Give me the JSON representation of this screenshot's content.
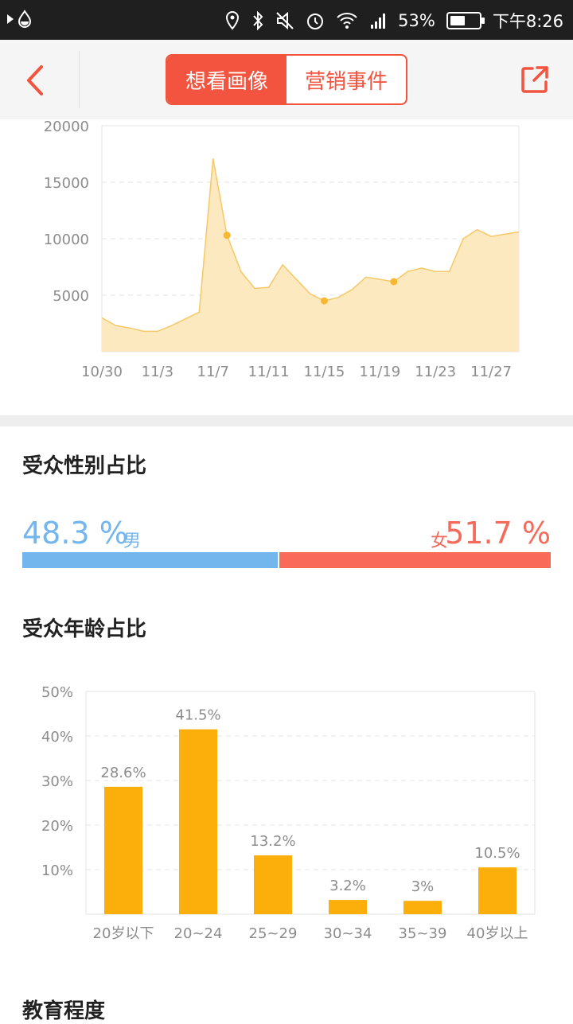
{
  "status_bar": {
    "battery_percent": "53%",
    "time": "下午8:26",
    "battery_level": 0.53
  },
  "nav": {
    "tabs": [
      "想看画像",
      "营销事件"
    ],
    "active_tab": 0
  },
  "trend_chart": {
    "chart_data": {
      "type": "area",
      "x": [
        "10/30",
        "10/31",
        "11/1",
        "11/2",
        "11/3",
        "11/4",
        "11/5",
        "11/6",
        "11/7",
        "11/8",
        "11/9",
        "11/10",
        "11/11",
        "11/12",
        "11/13",
        "11/14",
        "11/15",
        "11/16",
        "11/17",
        "11/18",
        "11/19",
        "11/20",
        "11/21",
        "11/22",
        "11/23",
        "11/24",
        "11/25",
        "11/26",
        "11/27",
        "11/28",
        "11/29"
      ],
      "values": [
        3000,
        2300,
        2100,
        1800,
        1800,
        2300,
        2900,
        3500,
        17100,
        10300,
        7100,
        5600,
        5700,
        7700,
        6400,
        5100,
        4500,
        4800,
        5500,
        6600,
        6400,
        6200,
        7100,
        7400,
        7100,
        7100,
        10000,
        10800,
        10200,
        10400,
        10600
      ],
      "marked_points": [
        9,
        16,
        21
      ],
      "xticks": [
        "10/30",
        "11/3",
        "11/7",
        "11/11",
        "11/15",
        "11/19",
        "11/23",
        "11/27"
      ],
      "yticks": [
        "5000",
        "10000",
        "15000",
        "20000"
      ],
      "ylim": [
        0,
        20000
      ],
      "grid": true,
      "colors": {
        "fill": "#fde9bf",
        "line": "#f6c867",
        "marker": "#f7b731"
      }
    }
  },
  "gender": {
    "title": "受众性别占比",
    "male_value": "48.3 %",
    "male_label": "男",
    "female_value": "51.7 %",
    "female_label": "女",
    "male_fraction": 0.483,
    "colors": {
      "male": "#73b6ee",
      "female": "#f96a58"
    }
  },
  "age": {
    "title": "受众年龄占比",
    "chart_data": {
      "type": "bar",
      "categories": [
        "20岁以下",
        "20~24",
        "25~29",
        "30~34",
        "35~39",
        "40岁以上"
      ],
      "values": [
        28.6,
        41.5,
        13.2,
        3.2,
        3,
        10.5
      ],
      "value_labels": [
        "28.6%",
        "41.5%",
        "13.2%",
        "3.2%",
        "3%",
        "10.5%"
      ],
      "yticks": [
        "10%",
        "20%",
        "30%",
        "40%",
        "50%"
      ],
      "ylim": [
        0,
        50
      ],
      "grid": true,
      "colors": {
        "bar": "#fcaf0b"
      }
    }
  },
  "education": {
    "title": "教育程度"
  }
}
